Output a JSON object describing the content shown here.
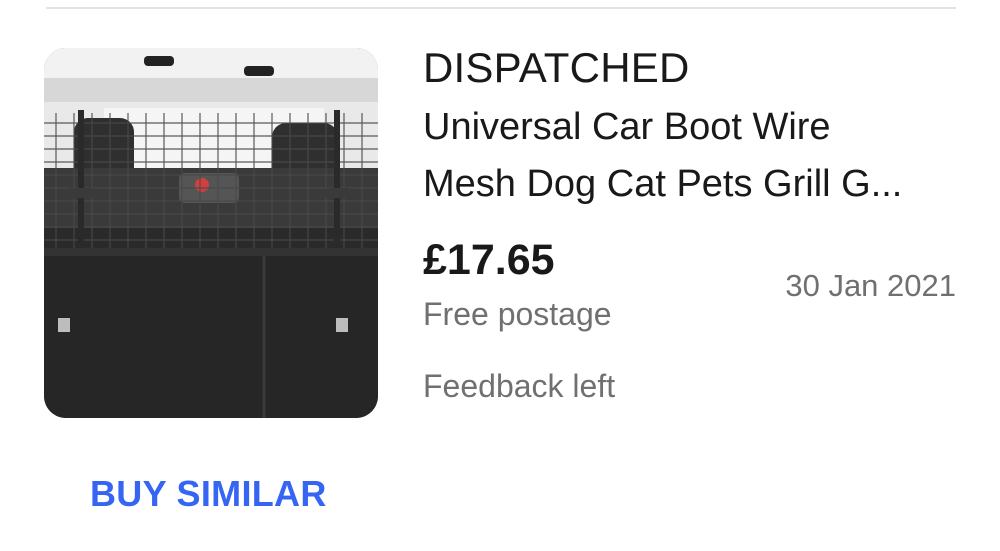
{
  "item": {
    "image_icon": "product-image",
    "status": "DISPATCHED",
    "title_line1": "Universal Car Boot Wire",
    "title_line2": "Mesh Dog Cat Pets Grill G...",
    "price": "£17.65",
    "postage": "Free postage",
    "date": "30 Jan 2021",
    "feedback": "Feedback left"
  },
  "actions": {
    "buy_similar_label": "BUY SIMILAR"
  },
  "colors": {
    "accent": "#3665f3",
    "text_primary": "#191919",
    "text_secondary": "#707070"
  }
}
